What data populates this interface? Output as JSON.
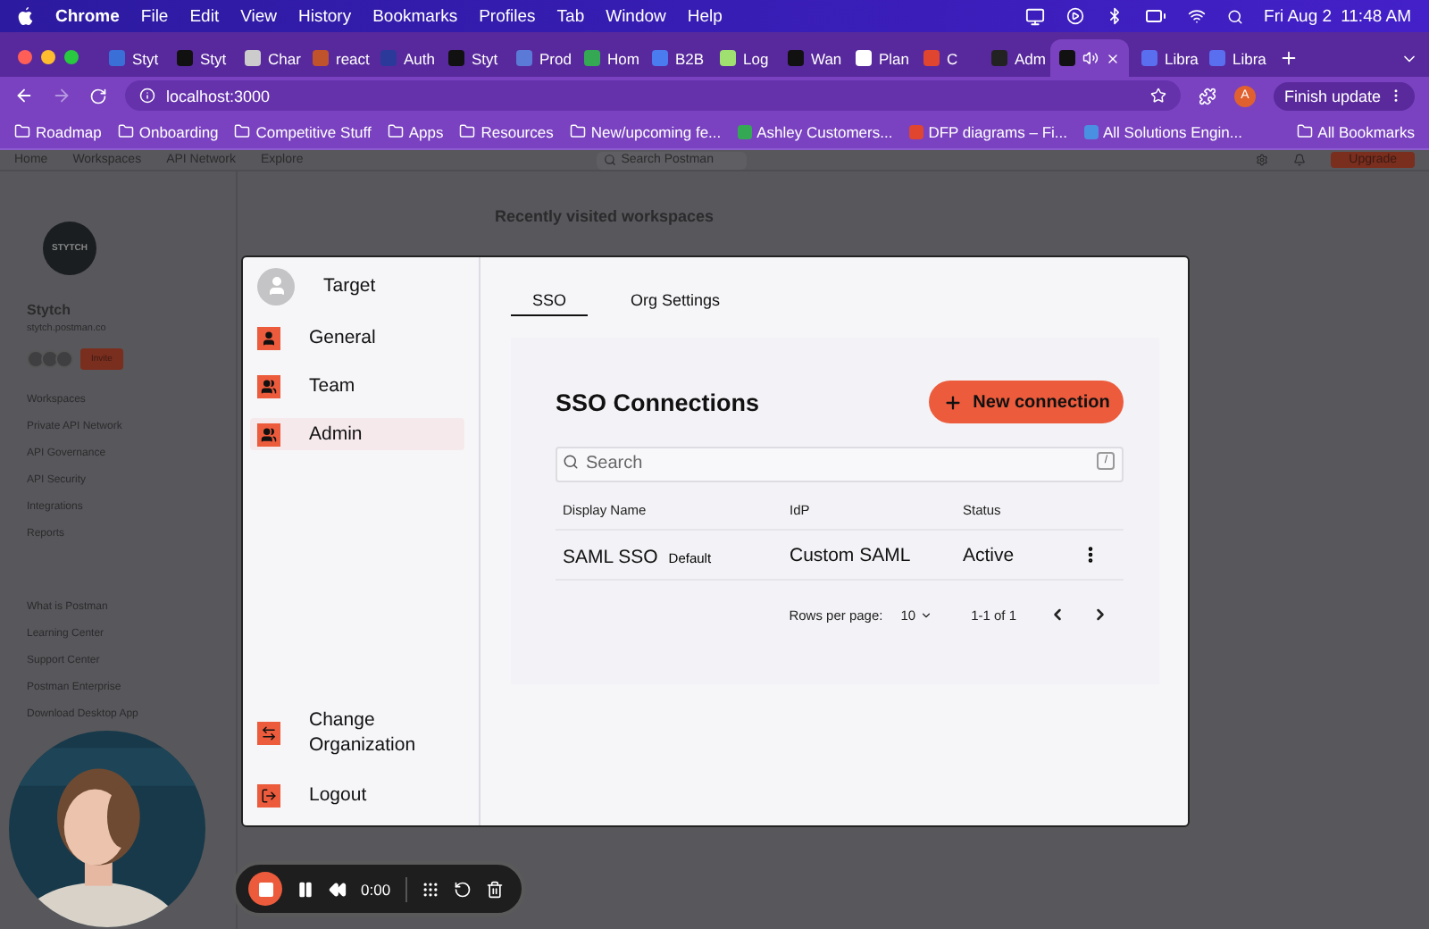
{
  "menu_bar": {
    "app_menus": [
      "Chrome",
      "File",
      "Edit",
      "View",
      "History",
      "Bookmarks",
      "Profiles",
      "Tab",
      "Window",
      "Help"
    ],
    "date": "Fri Aug 2",
    "time": "11:48 AM"
  },
  "tabs": [
    {
      "title": "Styt",
      "color": "#3b6fd8",
      "selected": false
    },
    {
      "title": "Styt",
      "color": "#111111",
      "selected": false
    },
    {
      "title": "Char",
      "color": "#cccccc",
      "selected": false
    },
    {
      "title": "react",
      "color": "#c0532b",
      "selected": false
    },
    {
      "title": "Auth",
      "color": "#2b3a9a",
      "selected": false
    },
    {
      "title": "Styt",
      "color": "#111111",
      "selected": false
    },
    {
      "title": "Prod",
      "color": "#5b7ad8",
      "selected": false
    },
    {
      "title": "Hom",
      "color": "#34a853",
      "selected": false
    },
    {
      "title": "B2B",
      "color": "#4a7cf0",
      "selected": false
    },
    {
      "title": "Log",
      "color": "#9fe070",
      "selected": false
    },
    {
      "title": "Wan",
      "color": "#111111",
      "selected": false
    },
    {
      "title": "Plan",
      "color": "#ffffff",
      "selected": false
    },
    {
      "title": "C",
      "color": "#e0452f",
      "selected": false
    },
    {
      "title": "Adm",
      "color": "#222222",
      "selected": false
    },
    {
      "color": "#111111",
      "selected": true,
      "audio": true
    },
    {
      "title": "Libra",
      "color": "#5a6ef0",
      "selected": false
    },
    {
      "title": "Libra",
      "color": "#5a6ef0",
      "selected": false
    }
  ],
  "address_bar": {
    "url": "localhost:3000"
  },
  "profile_initial": "A",
  "update_button": "Finish update",
  "bookmarks": [
    {
      "label": "Roadmap",
      "kind": "folder"
    },
    {
      "label": "Onboarding",
      "kind": "folder"
    },
    {
      "label": "Competitive Stuff",
      "kind": "folder"
    },
    {
      "label": "Apps",
      "kind": "folder"
    },
    {
      "label": "Resources",
      "kind": "folder"
    },
    {
      "label": "New/upcoming fe...",
      "kind": "folder"
    },
    {
      "label": "Ashley Customers...",
      "kind": "link",
      "color": "#34a853"
    },
    {
      "label": "DFP diagrams – Fi...",
      "kind": "link",
      "color": "#e0452f"
    },
    {
      "label": "All Solutions Engin...",
      "kind": "link",
      "color": "#4a90e2"
    }
  ],
  "all_bookmarks": "All Bookmarks",
  "background_page": {
    "nav": [
      "Home",
      "Workspaces",
      "API Network",
      "Explore"
    ],
    "search_placeholder": "Search Postman",
    "upgrade": "Upgrade",
    "logo_text": "STYTCH",
    "team_name": "Stytch",
    "team_domain": "stytch.postman.co",
    "invite": "Invite",
    "links": [
      "Workspaces",
      "Private API Network",
      "API Governance",
      "API Security",
      "Integrations",
      "Reports"
    ],
    "resources": [
      "What is Postman",
      "Learning Center",
      "Support Center",
      "Postman Enterprise",
      "Download Desktop App"
    ],
    "heading": "Recently visited workspaces"
  },
  "modal": {
    "user": "Target",
    "nav": [
      {
        "label": "General",
        "kind": "person",
        "selected": false
      },
      {
        "label": "Team",
        "kind": "group",
        "selected": false
      },
      {
        "label": "Admin",
        "kind": "group",
        "selected": true
      }
    ],
    "footer_nav": [
      {
        "label": "Change Organization",
        "kind": "switch"
      },
      {
        "label": "Logout",
        "kind": "logout"
      }
    ],
    "tabs": [
      {
        "label": "SSO",
        "selected": true
      },
      {
        "label": "Org Settings",
        "selected": false
      }
    ],
    "title": "SSO Connections",
    "new_button": "New connection",
    "search_placeholder": "Search",
    "search_shortcut": "/",
    "columns": [
      "Display Name",
      "IdP",
      "Status"
    ],
    "rows": [
      {
        "name": "SAML SSO",
        "badge": "Default",
        "idp": "Custom SAML",
        "status": "Active"
      }
    ],
    "rows_per_page_label": "Rows per page:",
    "rows_per_page": "10",
    "range": "1-1 of 1"
  },
  "recorder": {
    "time": "0:00"
  }
}
